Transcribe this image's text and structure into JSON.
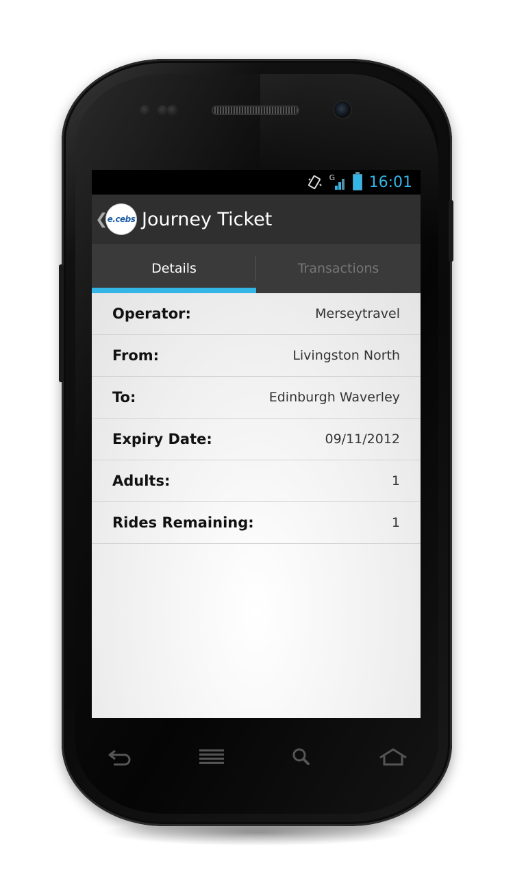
{
  "status_bar": {
    "time": "16:01",
    "network_label": "G"
  },
  "action_bar": {
    "up_caret": "❮",
    "logo_text": "e.cebs",
    "title": "Journey Ticket"
  },
  "tabs": [
    {
      "label": "Details",
      "active": true
    },
    {
      "label": "Transactions",
      "active": false
    }
  ],
  "details": [
    {
      "label": "Operator:",
      "value": "Merseytravel"
    },
    {
      "label": "From:",
      "value": "Livingston North"
    },
    {
      "label": "To:",
      "value": "Edinburgh Waverley"
    },
    {
      "label": "Expiry Date:",
      "value": "09/11/2012"
    },
    {
      "label": "Adults:",
      "value": "1"
    },
    {
      "label": "Rides Remaining:",
      "value": "1"
    }
  ],
  "nav_buttons": [
    "back-icon",
    "menu-icon",
    "search-icon",
    "home-icon"
  ],
  "colors": {
    "accent": "#33b5e5",
    "action_bar": "#2f2f2f",
    "tabs_bg": "#3a3a3a"
  }
}
